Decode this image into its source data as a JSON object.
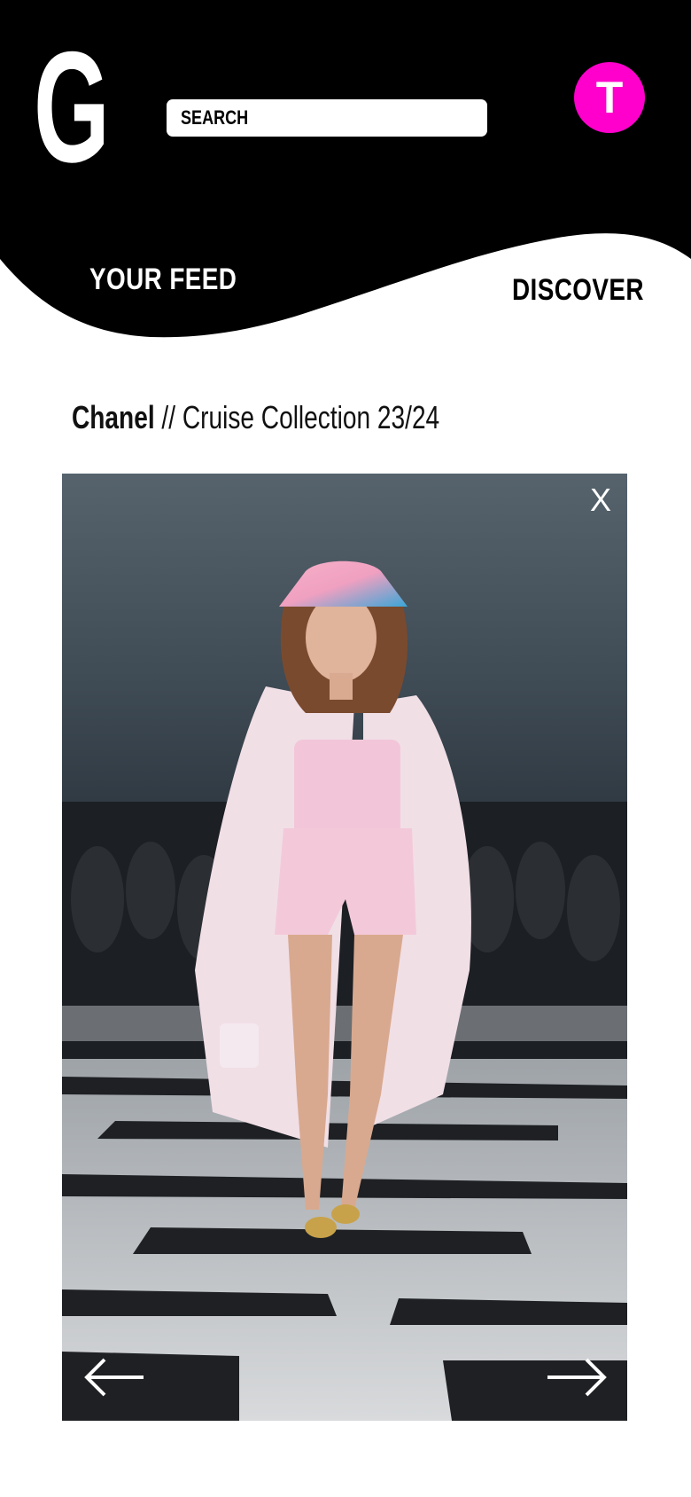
{
  "header": {
    "logo": "G",
    "search": {
      "placeholder": "SEARCH",
      "value": ""
    },
    "avatar_initial": "T"
  },
  "nav": {
    "your_feed": "YOUR FEED",
    "discover": "DISCOVER"
  },
  "collection": {
    "brand": "Chanel",
    "separator": "//",
    "season": "Cruise Collection 23/24"
  },
  "viewer": {
    "close_label": "X",
    "prev_icon": "arrow-left-icon",
    "next_icon": "arrow-right-icon"
  },
  "colors": {
    "header_bg": "#000000",
    "avatar_bg": "#ff00cc",
    "text_light": "#ffffff"
  }
}
